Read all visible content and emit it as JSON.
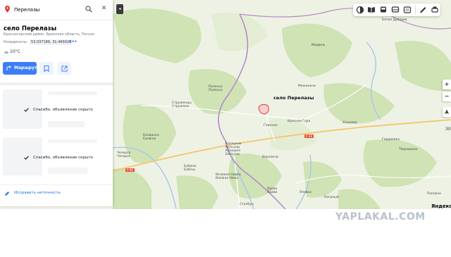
{
  "search": {
    "value": "Перелазы"
  },
  "place": {
    "title": "село Перелазы",
    "address": "Красногорский район, Брянская область, Россия",
    "coords_label": "Координаты:",
    "coords_value": "53.037186, 31.469026",
    "more": "•••",
    "temperature": "10°C"
  },
  "actions": {
    "route_label": "Маршрут"
  },
  "hidden_notes": [
    "Спасибо, объявление скрыто",
    "Спасибо, объявление скрыто"
  ],
  "report": {
    "label": "Исправить неточность"
  },
  "map": {
    "marker_label": "село Перелазы",
    "towns": [
      {
        "name": "Медвеж"
      },
      {
        "name": "Межаничи"
      },
      {
        "name": "Полесье Палесье"
      },
      {
        "name": "Струженцы Стружани"
      },
      {
        "name": "Красная Гора"
      },
      {
        "name": "Глинное"
      },
      {
        "name": "Уношево"
      },
      {
        "name": "Гордеевка"
      },
      {
        "name": "Творишино"
      },
      {
        "name": "Балвинка Балвіна"
      },
      {
        "name": "Чечерск Чачэрск"
      },
      {
        "name": "Казацкие Болсуны Казацкія Балсуны"
      },
      {
        "name": "Верхличи"
      },
      {
        "name": "Бабичи Бабічы"
      },
      {
        "name": "Великая Нивка Вялікая Нівка"
      },
      {
        "name": "Ядово Ядава"
      },
      {
        "name": "Яловка"
      },
      {
        "name": "Ногрный"
      },
      {
        "name": "Поповче"
      },
      {
        "name": "Столбун"
      },
      {
        "name": "Белая Дубрава"
      }
    ],
    "road_badges": [
      "Р-86",
      "Р-38"
    ],
    "scale": "30",
    "brand": "Яндекс"
  },
  "watermark": "YAPLAKAL.COM",
  "colors": {
    "accent": "#3d7df6",
    "marker": "#e53935",
    "border": "#b58cc7"
  },
  "icons": [
    "pin-icon",
    "search-icon",
    "close-icon",
    "weather-icon",
    "route-icon",
    "bookmark-icon",
    "share-icon",
    "check-icon",
    "pencil-icon",
    "layers-icon",
    "panorama-icon",
    "transit-icon",
    "bus-icon",
    "photo-icon",
    "ruler-icon",
    "print-icon",
    "zoom-in-icon",
    "zoom-out-icon",
    "compass-icon"
  ]
}
